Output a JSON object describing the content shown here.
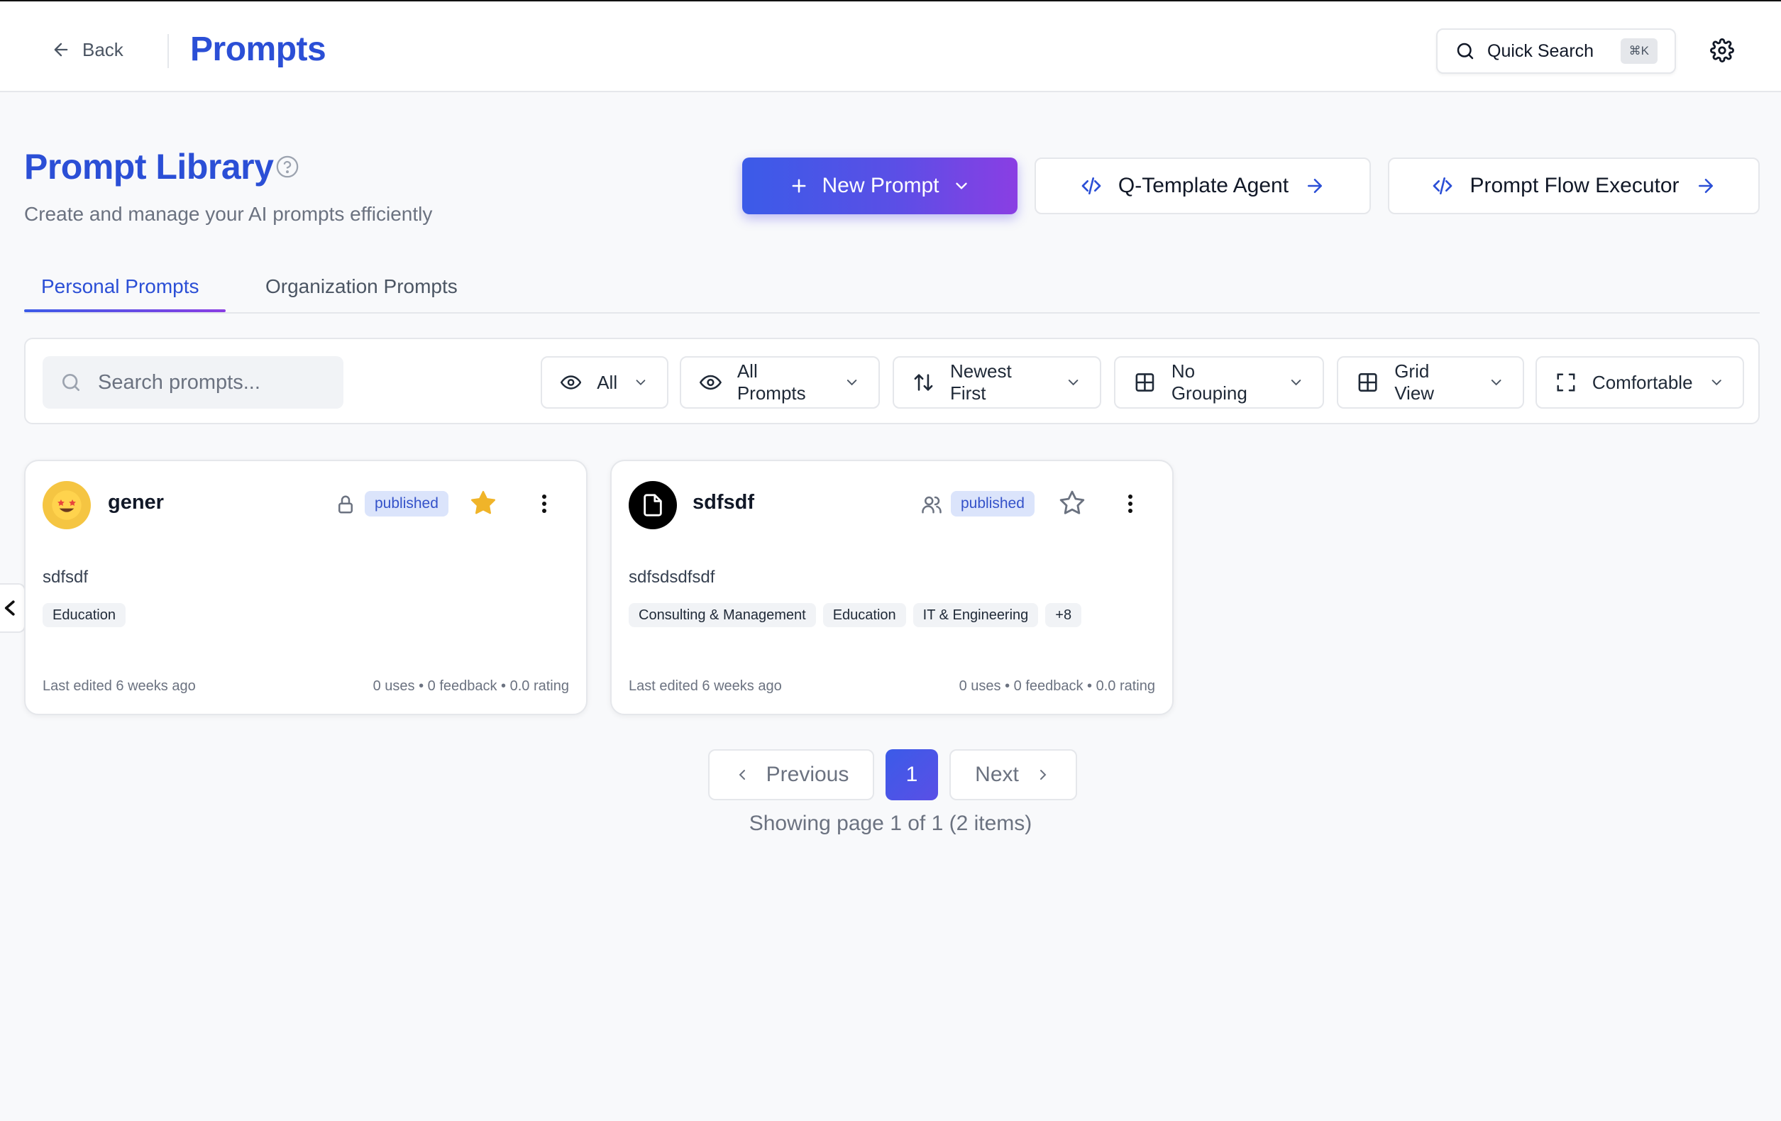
{
  "header": {
    "back_label": "Back",
    "title": "Prompts",
    "quick_search_label": "Quick Search",
    "quick_search_shortcut": "⌘K"
  },
  "page": {
    "title": "Prompt Library",
    "subtitle": "Create and manage your AI prompts efficiently"
  },
  "actions": {
    "new_prompt": "New Prompt",
    "q_template_agent": "Q-Template Agent",
    "prompt_flow_executor": "Prompt Flow Executor"
  },
  "tabs": [
    {
      "label": "Personal Prompts",
      "active": true
    },
    {
      "label": "Organization Prompts",
      "active": false
    }
  ],
  "filters": {
    "search_placeholder": "Search prompts...",
    "visibility": "All",
    "scope": "All Prompts",
    "sort": "Newest First",
    "grouping": "No Grouping",
    "view": "Grid View",
    "density": "Comfortable"
  },
  "cards": [
    {
      "name": "gener",
      "avatar": "star-struck-emoji",
      "visibility_icon": "lock-icon",
      "status": "published",
      "starred": true,
      "description": "sdfsdf",
      "tags": [
        "Education"
      ],
      "last_edited": "Last edited 6 weeks ago",
      "stats": "0 uses • 0 feedback • 0.0 rating"
    },
    {
      "name": "sdfsdf",
      "avatar": "document-icon",
      "visibility_icon": "users-icon",
      "status": "published",
      "starred": false,
      "description": "sdfsdsdfsdf",
      "tags": [
        "Consulting & Management",
        "Education",
        "IT & Engineering",
        "+8"
      ],
      "last_edited": "Last edited 6 weeks ago",
      "stats": "0 uses • 0 feedback • 0.0 rating"
    }
  ],
  "pagination": {
    "previous": "Previous",
    "current_page": "1",
    "next": "Next",
    "info": "Showing page 1 of 1 (2 items)"
  },
  "colors": {
    "accent": "#2b4fd6",
    "gradient_start": "#3b5be8",
    "gradient_end": "#8a3ee3",
    "star_filled": "#f0b429"
  }
}
